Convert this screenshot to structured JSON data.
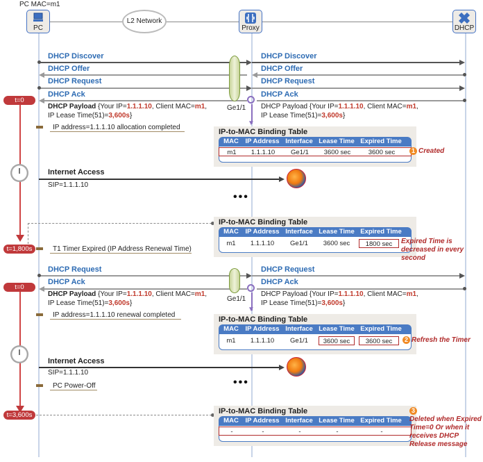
{
  "nodes": {
    "pc_caption": "PC MAC=m1",
    "pc": "PC",
    "network": "L2 Network",
    "proxy": "Proxy",
    "dhcp": "DHCP"
  },
  "interface_label": "Ge1/1",
  "phase1": {
    "messages": [
      "DHCP Discover",
      "DHCP Offer",
      "DHCP Request",
      "DHCP Ack"
    ],
    "payload": {
      "prefix": "DHCP Payload",
      "your_ip_label": " {Your IP=",
      "your_ip": "1.1.1.10",
      "client_mac_label": ", Client MAC=",
      "client_mac": "m1",
      "lease_label": "IP Lease Time(51)=",
      "lease": "3,600s",
      "suffix": "}"
    },
    "note": "IP address=1.1.1.10 allocation completed",
    "time_badge": "t=0",
    "internet_access": "Internet Access",
    "sip": "SIP=1.1.1.10"
  },
  "phase2": {
    "time_badge": "t=1,800s",
    "note": "T1 Timer Expired (IP Address Renewal Time)",
    "messages": [
      "DHCP Request",
      "DHCP Ack"
    ],
    "time_badge2": "t=0",
    "note2": "IP address=1.1.1.10 renewal completed",
    "internet_access": "Internet Access",
    "sip": "SIP=1.1.1.10",
    "note3": "PC Power-Off"
  },
  "phase3": {
    "time_badge": "t=3,600s"
  },
  "ellipsis": "•••",
  "binding_tables": [
    {
      "title": "IP-to-MAC Binding Table",
      "columns": [
        "MAC",
        "IP Address",
        "Interface",
        "Lease Time",
        "Expired Time"
      ],
      "row": [
        "m1",
        "1.1.1.10",
        "Ge1/1",
        "3600 sec",
        "3600 sec"
      ],
      "annotation_number": "1",
      "annotation": "Created"
    },
    {
      "title": "IP-to-MAC Binding Table",
      "columns": [
        "MAC",
        "IP Address",
        "Interface",
        "Lease Time",
        "Expired Time"
      ],
      "row": [
        "m1",
        "1.1.1.10",
        "Ge1/1",
        "3600 sec",
        "1800 sec"
      ],
      "annotation": "Expired Time is decreased in every second"
    },
    {
      "title": "IP-to-MAC Binding Table",
      "columns": [
        "MAC",
        "IP Address",
        "Interface",
        "Lease Time",
        "Expired Time"
      ],
      "row": [
        "m1",
        "1.1.1.10",
        "Ge1/1",
        "3600 sec",
        "3600 sec"
      ],
      "annotation_number": "2",
      "annotation": "Refresh the Timer"
    },
    {
      "title": "IP-to-MAC Binding Table",
      "columns": [
        "MAC",
        "IP Address",
        "Interface",
        "Lease Time",
        "Expired Time"
      ],
      "row": [
        "-",
        "-",
        "-",
        "-",
        "-"
      ],
      "annotation_number": "3",
      "annotation": "Deleted when Expired Time=0 Or when it receives DHCP Release message"
    }
  ],
  "colors": {
    "message_blue": "#2d6bb3",
    "highlight_red": "#c0392b",
    "table_header": "#4a7bc4",
    "badge_red": "#c0393b",
    "annotation_orange": "#f08a24"
  }
}
